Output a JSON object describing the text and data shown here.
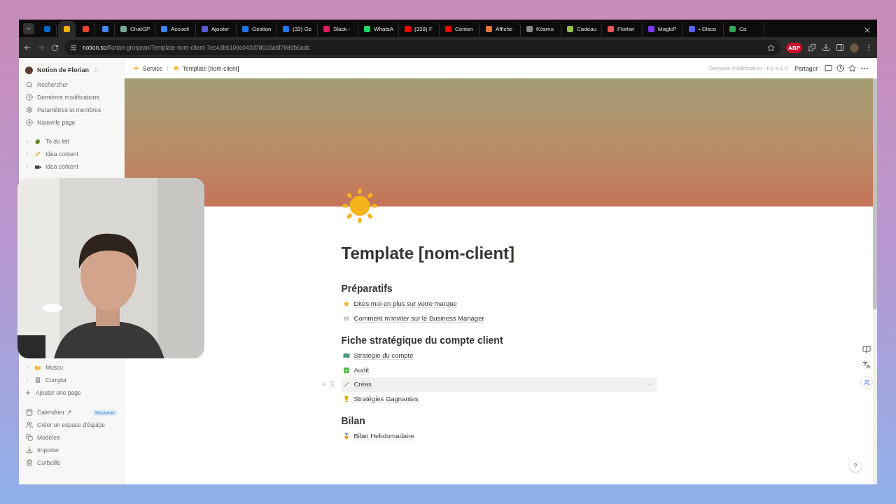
{
  "browser": {
    "tabs": [
      {
        "color": "#0a66c2",
        "selected": false
      },
      {
        "color": "#f4b400",
        "selected": true
      },
      {
        "color": "#ea4335",
        "selected": false
      },
      {
        "color": "#4285f4",
        "selected": false
      },
      {
        "label": "ChatGP",
        "color": "#74aa9c",
        "selected": false
      },
      {
        "label": "Accueil",
        "color": "#3b82f6",
        "selected": false
      },
      {
        "label": "Ajouter",
        "color": "#5b5bd6",
        "selected": false
      },
      {
        "label": "Gestion",
        "color": "#1877f2",
        "selected": false
      },
      {
        "label": "(33) Ge",
        "color": "#1877f2",
        "selected": false
      },
      {
        "label": "Slack -",
        "color": "#e01e5a",
        "selected": false
      },
      {
        "label": "WhatsA",
        "color": "#25d366",
        "selected": false
      },
      {
        "label": "(338) F",
        "color": "#ff0000",
        "selected": false
      },
      {
        "label": "Conten",
        "color": "#ff0000",
        "selected": false
      },
      {
        "label": "Affiche",
        "color": "#e8743b",
        "selected": false
      },
      {
        "label": "Kósmo",
        "color": "#888888",
        "selected": false
      },
      {
        "label": "Cadeau",
        "color": "#95bf47",
        "selected": false
      },
      {
        "label": "Florian",
        "color": "#e0574f",
        "selected": false
      },
      {
        "label": "MagicP",
        "color": "#7c3aed",
        "selected": false
      },
      {
        "label": "• Disco",
        "color": "#5865f2",
        "selected": false
      },
      {
        "label": "Ca",
        "color": "#34a853",
        "selected": false
      }
    ],
    "address": {
      "domain": "notion.so",
      "path": "/florian-grosjean/Template-nom-client-7ec43b6109c043d78010a6f7989b5adc"
    },
    "extension_badge": "ABP"
  },
  "sidebar": {
    "workspace": "Notion de Florian",
    "nav": [
      {
        "label": "Rechercher"
      },
      {
        "label": "Dernières modifications"
      },
      {
        "label": "Paramètres et membres"
      },
      {
        "label": "Nouvelle page"
      }
    ],
    "pages_top": [
      {
        "label": "To do list",
        "kind": "avocado"
      },
      {
        "label": "Idea content",
        "kind": "pencil"
      },
      {
        "label": "Idea content",
        "kind": "camera"
      }
    ],
    "pages_bottom": [
      {
        "label": "Muscu",
        "kind": "folder"
      },
      {
        "label": "Compta",
        "kind": "book"
      }
    ],
    "add_page": "Ajouter une page",
    "footer": [
      {
        "label": "Calendrier ↗",
        "badge": "Nouveau"
      },
      {
        "label": "Créer un espace d'équipe"
      },
      {
        "label": "Modèles"
      },
      {
        "label": "Importer"
      },
      {
        "label": "Corbeille"
      }
    ]
  },
  "topbar": {
    "breadcrumb": [
      {
        "label": "Service",
        "kind": "bowl"
      },
      {
        "label": "Template [nom-client]",
        "kind": "sun"
      }
    ],
    "separator": "/",
    "last_edit": "Dernière modification : Il y a 1 h",
    "share": "Partager"
  },
  "page": {
    "title": "Template [nom-client]",
    "sections": [
      {
        "heading": "Préparatifs",
        "items": [
          {
            "label": "Dites moi en plus sur votre marque",
            "kind": "star",
            "hovered": false
          },
          {
            "label": "Comment m'inviter sur le Business Manager",
            "kind": "mail",
            "hovered": false
          }
        ]
      },
      {
        "heading": "Fiche stratégique du compte client",
        "items": [
          {
            "label": "Stratégie du compte",
            "kind": "map",
            "hovered": false
          },
          {
            "label": "Audit",
            "kind": "check",
            "hovered": false
          },
          {
            "label": "Créas",
            "kind": "wand",
            "hovered": true
          },
          {
            "label": "Stratégies Gagnantes",
            "kind": "trophy",
            "hovered": false
          }
        ]
      },
      {
        "heading": "Bilan",
        "items": [
          {
            "label": "Bilan Hebdomadaire",
            "kind": "medal",
            "hovered": false
          }
        ]
      }
    ]
  },
  "help": "?"
}
